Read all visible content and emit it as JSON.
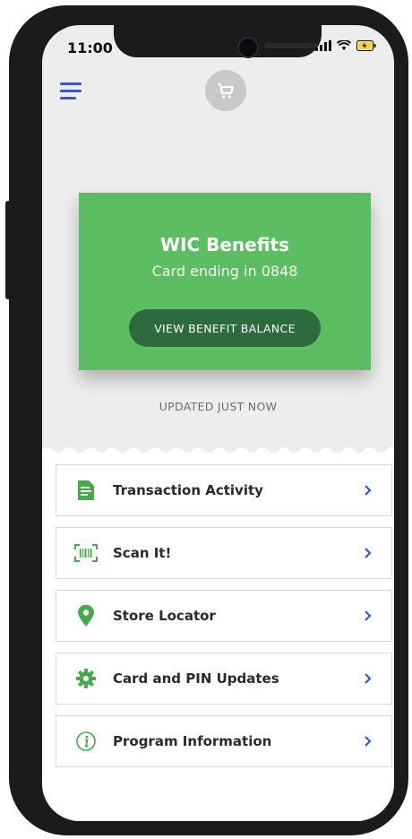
{
  "status_bar": {
    "time": "11:00"
  },
  "card": {
    "title": "WIC Benefits",
    "subtitle": "Card ending in 0848",
    "button_label": "VIEW BENEFIT BALANCE"
  },
  "updated_text": "UPDATED JUST NOW",
  "menu_items": [
    {
      "label": "Transaction Activity",
      "icon": "document-icon"
    },
    {
      "label": "Scan It!",
      "icon": "barcode-scan-icon"
    },
    {
      "label": "Store Locator",
      "icon": "location-pin-icon"
    },
    {
      "label": "Card and PIN Updates",
      "icon": "gear-icon"
    },
    {
      "label": "Program Information",
      "icon": "info-icon"
    }
  ],
  "colors": {
    "card_green": "#5dbd63",
    "button_dark_green": "#2d6a3e",
    "icon_green": "#48a84e",
    "menu_blue": "#3a57c2",
    "chevron_blue": "#2f5fb8"
  }
}
